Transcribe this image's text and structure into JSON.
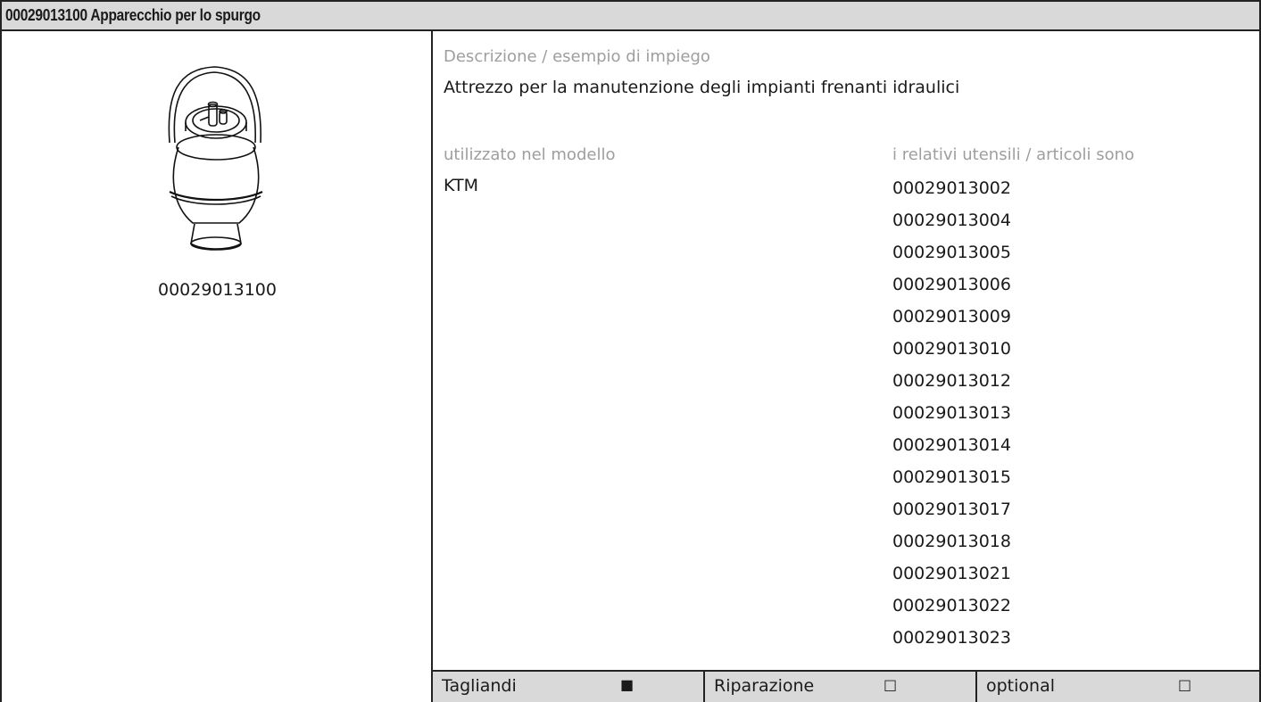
{
  "header": {
    "title": "00029013100 Apparecchio per lo spurgo"
  },
  "left_panel": {
    "image_icon": "bleeding-device-icon",
    "item_code": "00029013100"
  },
  "description": {
    "label": "Descrizione / esempio di impiego",
    "text": "Attrezzo per la manutenzione degli impianti frenanti idraulici"
  },
  "used_in": {
    "label": "utilizzato nel modello",
    "value": "KTM"
  },
  "related": {
    "label": "i relativi utensili / articoli sono",
    "items": [
      "00029013002",
      "00029013004",
      "00029013005",
      "00029013006",
      "00029013009",
      "00029013010",
      "00029013012",
      "00029013013",
      "00029013014",
      "00029013015",
      "00029013017",
      "00029013018",
      "00029013021",
      "00029013022",
      "00029013023"
    ]
  },
  "footer": {
    "cells": [
      {
        "label": "Tagliandi",
        "mark": "■"
      },
      {
        "label": "Riparazione",
        "mark": "□"
      },
      {
        "label": "optional",
        "mark": "□"
      }
    ]
  }
}
